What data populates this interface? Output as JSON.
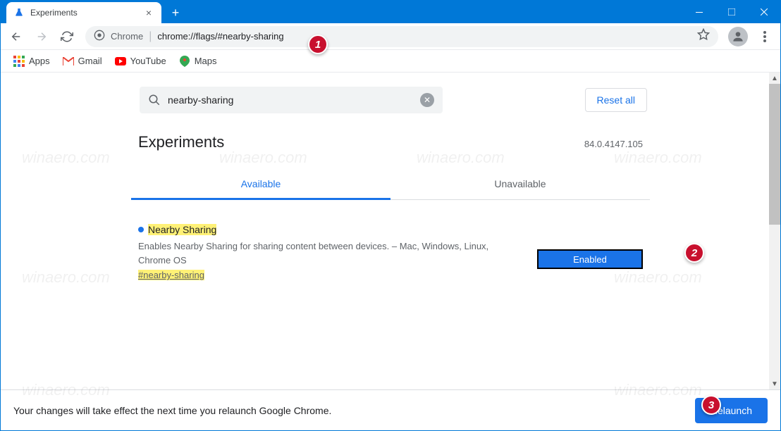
{
  "window": {
    "tab_title": "Experiments"
  },
  "address": {
    "chip": "Chrome",
    "url": "chrome://flags/#nearby-sharing"
  },
  "bookmarks": [
    {
      "label": "Apps",
      "icon": "apps"
    },
    {
      "label": "Gmail",
      "icon": "gmail"
    },
    {
      "label": "YouTube",
      "icon": "youtube"
    },
    {
      "label": "Maps",
      "icon": "maps"
    }
  ],
  "search": {
    "value": "nearby-sharing",
    "icon": "search"
  },
  "reset_label": "Reset all",
  "page_title": "Experiments",
  "version": "84.0.4147.105",
  "tabs": {
    "available": "Available",
    "unavailable": "Unavailable"
  },
  "flag": {
    "title": "Nearby Sharing",
    "desc": "Enables Nearby Sharing for sharing content between devices. – Mac, Windows, Linux, Chrome OS",
    "anchor": "#nearby-sharing",
    "select_value": "Enabled"
  },
  "footer": {
    "text": "Your changes will take effect the next time you relaunch Google Chrome.",
    "button": "Relaunch"
  },
  "callouts": [
    "1",
    "2",
    "3"
  ],
  "watermark": "winaero.com"
}
